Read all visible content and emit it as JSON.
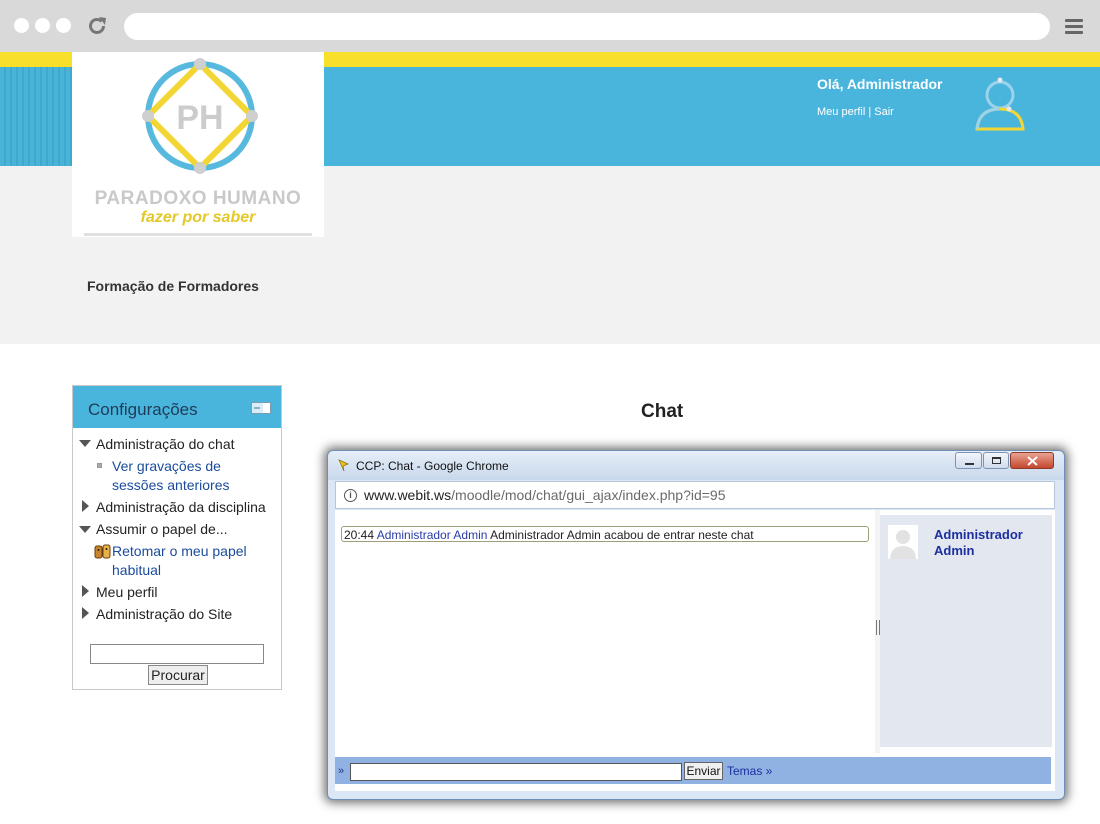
{
  "site": {
    "brand_name": "PARADOXO HUMANO",
    "tagline": "fazer por saber",
    "logo_letters": "PH",
    "colors": {
      "header_blue": "#4ab5dc",
      "accent_yellow": "#f7df2a",
      "link_blue": "#1a4b9c"
    }
  },
  "header": {
    "greeting": "Olá, Administrador",
    "profile_link": "Meu perfil",
    "separator": "|",
    "logout_link": "Sair"
  },
  "course": {
    "title": "Formação de Formadores"
  },
  "settings": {
    "title": "Configurações",
    "items": [
      {
        "label": "Administração do chat",
        "state": "expanded"
      },
      {
        "label": "Ver gravações de sessões anteriores",
        "state": "link"
      },
      {
        "label": "Administração da disciplina",
        "state": "collapsed"
      },
      {
        "label": "Assumir o papel de...",
        "state": "expanded"
      },
      {
        "label": "Retomar o meu papel habitual",
        "state": "link"
      },
      {
        "label": "Meu perfil",
        "state": "collapsed"
      },
      {
        "label": "Administração do Site",
        "state": "collapsed"
      }
    ],
    "search_value": "",
    "search_button": "Procurar"
  },
  "main": {
    "heading": "Chat"
  },
  "popup": {
    "title": "CCP: Chat - Google Chrome",
    "url_host": "www.webit.ws",
    "url_path": "/moodle/mod/chat/gui_ajax/index.php?id=95",
    "message": {
      "time": "20:44",
      "user": "Administrador Admin",
      "text": "Administrador Admin acabou de entrar neste chat"
    },
    "users": [
      {
        "name": "Administrador Admin"
      }
    ],
    "input_prompt": "»",
    "input_value": "",
    "send_button": "Enviar",
    "themes_link": "Temas »"
  }
}
